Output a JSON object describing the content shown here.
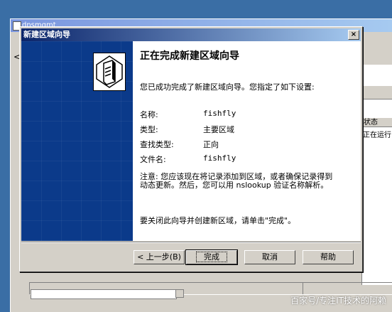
{
  "background_window": {
    "title": "dnsmgmt",
    "list_header": "状态",
    "list_cell": "正在运行",
    "nav_arrow": "<"
  },
  "wizard": {
    "title": "新建区域向导",
    "close_glyph": "×",
    "heading": "正在完成新建区域向导",
    "intro": "您已成功完成了新建区域向导。您指定了如下设置:",
    "settings": [
      {
        "label": "名称:",
        "value": "fishfly"
      },
      {
        "label": "类型:",
        "value": "主要区域"
      },
      {
        "label": "查找类型:",
        "value": "正向"
      },
      {
        "label": "文件名:",
        "value": "fishfly"
      }
    ],
    "note": "注意: 您应该现在将记录添加到区域，或者确保记录得到动态更新。然后，您可以用 nslookup 验证名称解析。",
    "closing": "要关闭此向导并创建新区域，请单击\"完成\"。",
    "buttons": {
      "back": "< 上一步(B)",
      "finish": "完成",
      "cancel": "取消",
      "help": "帮助"
    },
    "side_icon": "server-icon"
  },
  "watermark": "百家号/专注IT技术的阿赖"
}
